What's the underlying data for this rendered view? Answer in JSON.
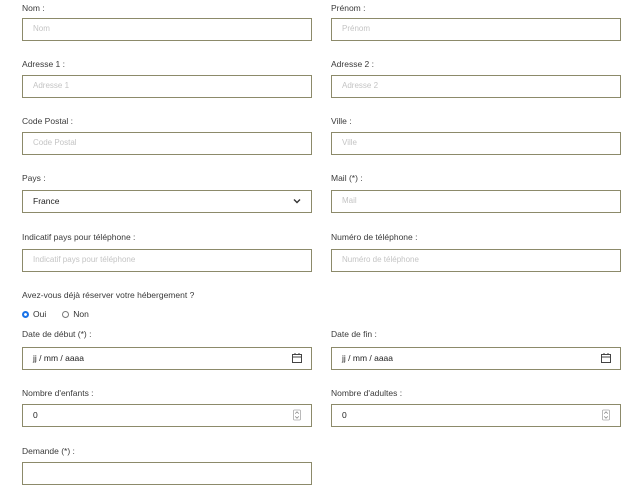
{
  "form": {
    "nom": {
      "label": "Nom :",
      "placeholder": "Nom"
    },
    "prenom": {
      "label": "Prénom :",
      "placeholder": "Prénom"
    },
    "adresse1": {
      "label": "Adresse 1 :",
      "placeholder": "Adresse 1"
    },
    "adresse2": {
      "label": "Adresse 2 :",
      "placeholder": "Adresse 2"
    },
    "code_postal": {
      "label": "Code Postal :",
      "placeholder": "Code Postal"
    },
    "ville": {
      "label": "Ville :",
      "placeholder": "Ville"
    },
    "pays": {
      "label": "Pays :",
      "value": "France",
      "icon": "chevron-down-icon"
    },
    "mail": {
      "label": "Mail (*) :",
      "placeholder": "Mail"
    },
    "indicatif": {
      "label": "Indicatif pays pour téléphone :",
      "placeholder": "Indicatif pays pour téléphone"
    },
    "telephone": {
      "label": "Numéro de téléphone :",
      "placeholder": "Numéro de téléphone"
    },
    "hebergement": {
      "question": "Avez-vous déjà réserver votre hébergement ?",
      "options": [
        "Oui",
        "Non"
      ],
      "selected": "Oui"
    },
    "date_debut": {
      "label": "Date de début (*) :",
      "value": "jj / mm / aaaa",
      "icon": "calendar-icon"
    },
    "date_fin": {
      "label": "Date de fin :",
      "value": "jj / mm / aaaa",
      "icon": "calendar-icon"
    },
    "enfants": {
      "label": "Nombre d'enfants :",
      "value": "0",
      "icon": "spinner-icon"
    },
    "adultes": {
      "label": "Nombre d'adultes :",
      "value": "0",
      "icon": "spinner-icon"
    },
    "demande": {
      "label": "Demande (*) :"
    }
  },
  "colors": {
    "border": "#8c8a6a",
    "radio_accent": "#1a73e8"
  }
}
